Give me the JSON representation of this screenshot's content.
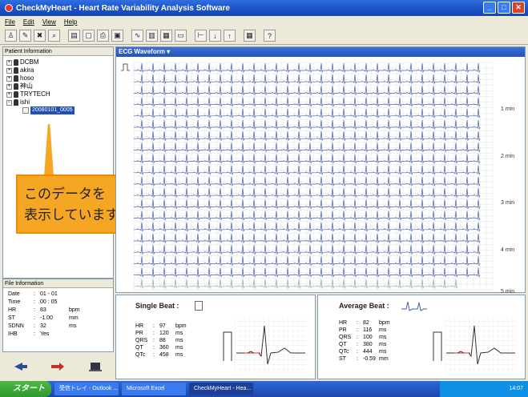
{
  "window": {
    "title": "CheckMyHeart - Heart Rate Variability Analysis Software",
    "minimize": "_",
    "maximize": "□",
    "close": "✕"
  },
  "menu": [
    "File",
    "Edit",
    "View",
    "Help"
  ],
  "toolbar": {
    "icons": [
      "patient-add-icon",
      "patient-edit-icon",
      "patient-delete-icon",
      "patient-search-icon",
      "file-new-icon",
      "file-open-icon",
      "print-icon",
      "save-icon",
      "waveform-icon",
      "chart-icon",
      "trend-icon",
      "record-icon",
      "marker-icon",
      "down-arrow-icon",
      "up-arrow-icon",
      "calendar-icon",
      "help-icon"
    ],
    "glyphs": [
      "♙",
      "✎",
      "✖",
      "⌕",
      "▤",
      "▢",
      "⎙",
      "▣",
      "∿",
      "▥",
      "▦",
      "▭",
      "⊢",
      "↓",
      "↑",
      "▦",
      "?"
    ]
  },
  "patient_panel": {
    "title": "Patient Information",
    "patients": [
      "DCBM",
      "akira",
      "hoso",
      "神山",
      "TRYTECH",
      "ishi"
    ],
    "selected_record": "20080101_0005"
  },
  "callout": {
    "line1": "このデータを",
    "line2": "表示しています。"
  },
  "file_info": {
    "title": "File Information",
    "rows": [
      {
        "label": "Date",
        "sep": ":",
        "value": "01 - 01",
        "unit": ""
      },
      {
        "label": "Time",
        "sep": ":",
        "value": "00 : 05",
        "unit": ""
      },
      {
        "label": "HR",
        "sep": ":",
        "value": "83",
        "unit": "bpm"
      },
      {
        "label": "ST",
        "sep": ":",
        "value": "-1.00",
        "unit": "mm"
      },
      {
        "label": "SDNN",
        "sep": ":",
        "value": "32",
        "unit": "ms"
      },
      {
        "label": "IHB",
        "sep": ":",
        "value": "Yes",
        "unit": ""
      }
    ]
  },
  "ecg": {
    "title": "ECG Waveform ▾",
    "minute_labels": [
      "1 min",
      "2 min",
      "3 min",
      "4 min",
      "5 min"
    ],
    "trace_color": "#4a5fa8",
    "grid_color": "#e0e0e0"
  },
  "single_beat": {
    "title": "Single Beat :",
    "stats": [
      {
        "label": "HR",
        "sep": ":",
        "value": "97",
        "unit": "bpm"
      },
      {
        "label": "PR",
        "sep": ":",
        "value": "120",
        "unit": "ms"
      },
      {
        "label": "QRS",
        "sep": ":",
        "value": "88",
        "unit": "ms"
      },
      {
        "label": "QT",
        "sep": ":",
        "value": "360",
        "unit": "ms"
      },
      {
        "label": "QTc",
        "sep": ":",
        "value": "458",
        "unit": "ms"
      }
    ]
  },
  "average_beat": {
    "title": "Average Beat :",
    "stats": [
      {
        "label": "HR",
        "sep": ":",
        "value": "82",
        "unit": "bpm"
      },
      {
        "label": "PR",
        "sep": ":",
        "value": "116",
        "unit": "ms"
      },
      {
        "label": "QRS",
        "sep": ":",
        "value": "100",
        "unit": "ms"
      },
      {
        "label": "QT",
        "sep": ":",
        "value": "380",
        "unit": "ms"
      },
      {
        "label": "QTc",
        "sep": ":",
        "value": "444",
        "unit": "ms"
      },
      {
        "label": "ST",
        "sep": ":",
        "value": "-0.59",
        "unit": "mm"
      }
    ]
  },
  "taskbar": {
    "start": "スタート",
    "tasks": [
      "受信トレイ - Outlook ...",
      "Microsoft Excel",
      "CheckMyHeart - Hea..."
    ],
    "clock": "14:07"
  }
}
